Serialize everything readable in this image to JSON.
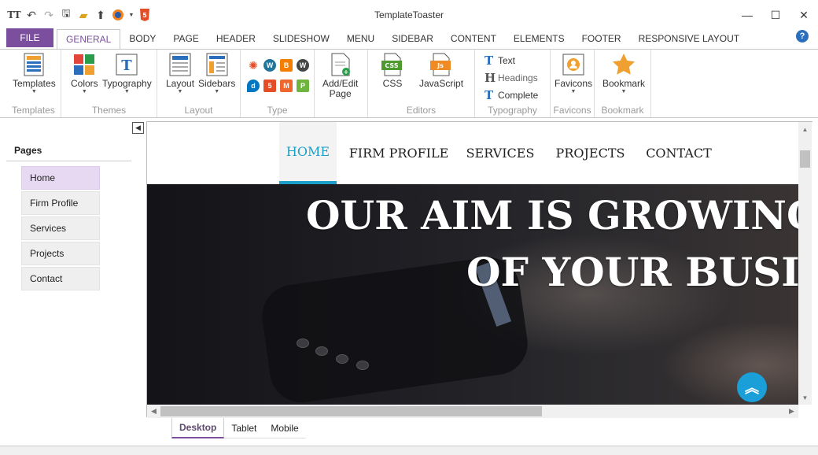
{
  "window": {
    "title": "TemplateToaster"
  },
  "ribbon_tabs": {
    "file": "FILE",
    "tabs": [
      "GENERAL",
      "BODY",
      "PAGE",
      "HEADER",
      "SLIDESHOW",
      "MENU",
      "SIDEBAR",
      "CONTENT",
      "ELEMENTS",
      "FOOTER",
      "RESPONSIVE LAYOUT"
    ],
    "active": "GENERAL"
  },
  "ribbon": {
    "templates": {
      "button": "Templates",
      "group": "Templates"
    },
    "themes": {
      "colors": "Colors",
      "typography": "Typography",
      "group": "Themes"
    },
    "layout": {
      "layout": "Layout",
      "sidebars": "Sidebars",
      "group": "Layout"
    },
    "type": {
      "group": "Type"
    },
    "add_edit": {
      "line1": "Add/Edit",
      "line2": "Page"
    },
    "editors": {
      "css": "CSS",
      "javascript": "JavaScript",
      "group": "Editors"
    },
    "typography_group": {
      "text": "Text",
      "headings": "Headings",
      "complete": "Complete",
      "group": "Typography"
    },
    "favicons": {
      "button": "Favicons",
      "group": "Favicons"
    },
    "bookmark": {
      "button": "Bookmark",
      "group": "Bookmark"
    }
  },
  "left_pane": {
    "title": "Pages",
    "pages": [
      "Home",
      "Firm Profile",
      "Services",
      "Projects",
      "Contact"
    ],
    "active": "Home"
  },
  "site": {
    "nav": [
      "HOME",
      "FIRM PROFILE",
      "SERVICES",
      "PROJECTS",
      "CONTACT"
    ],
    "active": "HOME",
    "hero_line1": "OUR AIM IS GROWING A",
    "hero_line2": "OF YOUR BUSIN",
    "scroll_top_icon": "double-chevron-up-icon"
  },
  "device_tabs": {
    "tabs": [
      "Desktop",
      "Tablet",
      "Mobile"
    ],
    "active": "Desktop"
  },
  "colors": {
    "accent": "#7b4f9e",
    "link": "#1a9fc9",
    "help": "#2a6ebc"
  }
}
